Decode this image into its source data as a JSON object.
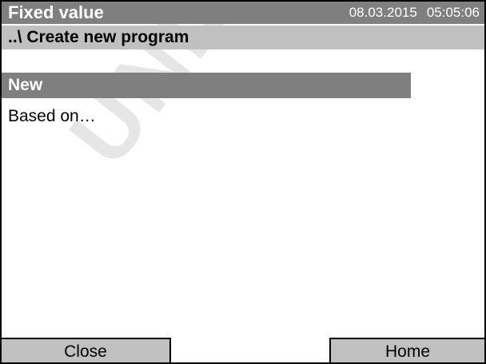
{
  "header": {
    "title": "Fixed value",
    "date": "08.03.2015",
    "time": "05:05:06"
  },
  "breadcrumb": {
    "path": "..\\ Create new program"
  },
  "menu": {
    "items": [
      {
        "label": "New",
        "selected": true
      },
      {
        "label": "Based on…",
        "selected": false
      }
    ]
  },
  "footer": {
    "close_label": "Close",
    "home_label": "Home"
  },
  "watermark": {
    "text": "UNIQUE"
  },
  "colors": {
    "header_bg": "#7f7f7f",
    "path_bg": "#c0c0c0",
    "selected_bg": "#7f7f7f",
    "button_bg": "#c0c0c0"
  }
}
